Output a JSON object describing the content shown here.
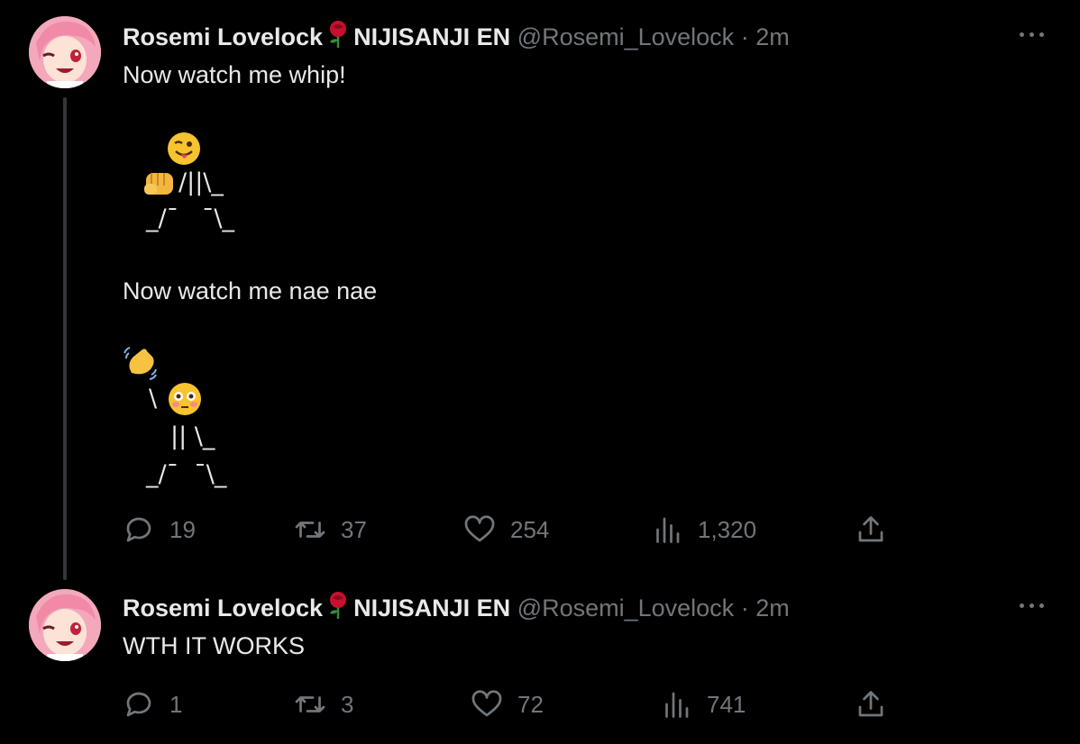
{
  "tweets": [
    {
      "display_name": "Rosemi Lovelock",
      "affiliation": "NIJISANJI EN",
      "handle": "@Rosemi_Lovelock",
      "separator": "·",
      "time": "2m",
      "text_line1": "Now watch me whip!",
      "ascii_whip": [
        "/||\\_",
        "_/¯   ¯\\_"
      ],
      "text_line2": "Now watch me nae nae",
      "ascii_naenae": [
        "\\",
        "|| \\_",
        "_/¯  ¯\\_"
      ],
      "replies": "19",
      "retweets": "37",
      "likes": "254",
      "views": "1,320"
    },
    {
      "display_name": "Rosemi Lovelock",
      "affiliation": "NIJISANJI EN",
      "handle": "@Rosemi_Lovelock",
      "separator": "·",
      "time": "2m",
      "text": "WTH IT WORKS",
      "replies": "1",
      "retweets": "3",
      "likes": "72",
      "views": "741"
    }
  ],
  "icons": {
    "reply": "reply-icon",
    "retweet": "retweet-icon",
    "like": "heart-icon",
    "views": "views-icon",
    "share": "share-icon",
    "more": "more-icon",
    "rose": "rose-emoji"
  },
  "colors": {
    "background": "#000000",
    "text": "#e7e9ea",
    "secondary": "#71767b",
    "thread_line": "#333639"
  }
}
